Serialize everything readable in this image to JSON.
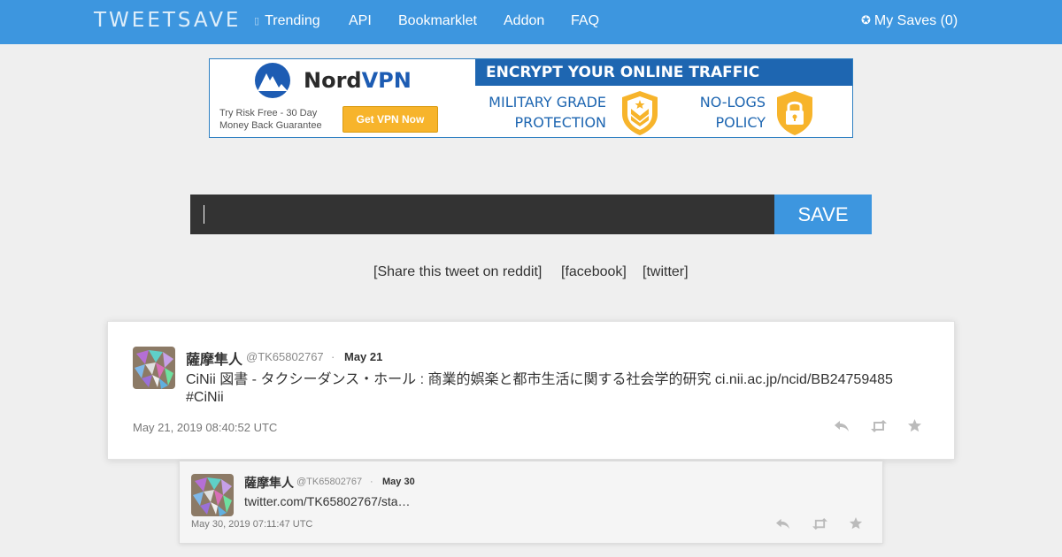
{
  "navbar": {
    "logo": "TWEETSAVE",
    "items": [
      {
        "label": "Trending",
        "icon": "trending-icon"
      },
      {
        "label": "API"
      },
      {
        "label": "Bookmarklet"
      },
      {
        "label": "Addon"
      },
      {
        "label": "FAQ"
      }
    ],
    "my_saves": {
      "label": "My Saves (0)",
      "icon": "plus-circle-icon"
    },
    "color": "#3d96df"
  },
  "ad": {
    "brand": "Nord",
    "brand_suffix": "VPN",
    "risk_text": "Try Risk Free - 30 Day Money Back Guarantee",
    "cta": "Get VPN Now",
    "headline": "ENCRYPT YOUR ONLINE TRAFFIC",
    "feature1": "MILITARY GRADE PROTECTION",
    "feature2": "NO-LOGS POLICY",
    "colors": {
      "blue": "#1e66b1",
      "gold": "#f7b42b"
    }
  },
  "search": {
    "value": "",
    "placeholder": "",
    "button_label": "SAVE"
  },
  "share": {
    "reddit": "[Share this tweet on reddit]",
    "facebook": "[facebook]",
    "twitter": "[twitter]"
  },
  "tweets": [
    {
      "name": "薩摩隼人",
      "handle": "@TK65802767",
      "separator": "·",
      "date": "May 21",
      "text": "CiNii 図書 - タクシーダンス・ホール : 商業的娯楽と都市生活に関する社会学的研究 ci.nii.ac.jp/ncid/BB24759485 #CiNii",
      "timestamp": "May 21, 2019 08:40:52 UTC",
      "actions": [
        "reply-icon",
        "retweet-icon",
        "favorite-icon"
      ]
    },
    {
      "name": "薩摩隼人",
      "handle": "@TK65802767",
      "separator": "·",
      "date": "May 30",
      "text": "twitter.com/TK65802767/sta…",
      "timestamp": "May 30, 2019 07:11:47 UTC",
      "actions": [
        "reply-icon",
        "retweet-icon",
        "favorite-icon"
      ]
    }
  ]
}
